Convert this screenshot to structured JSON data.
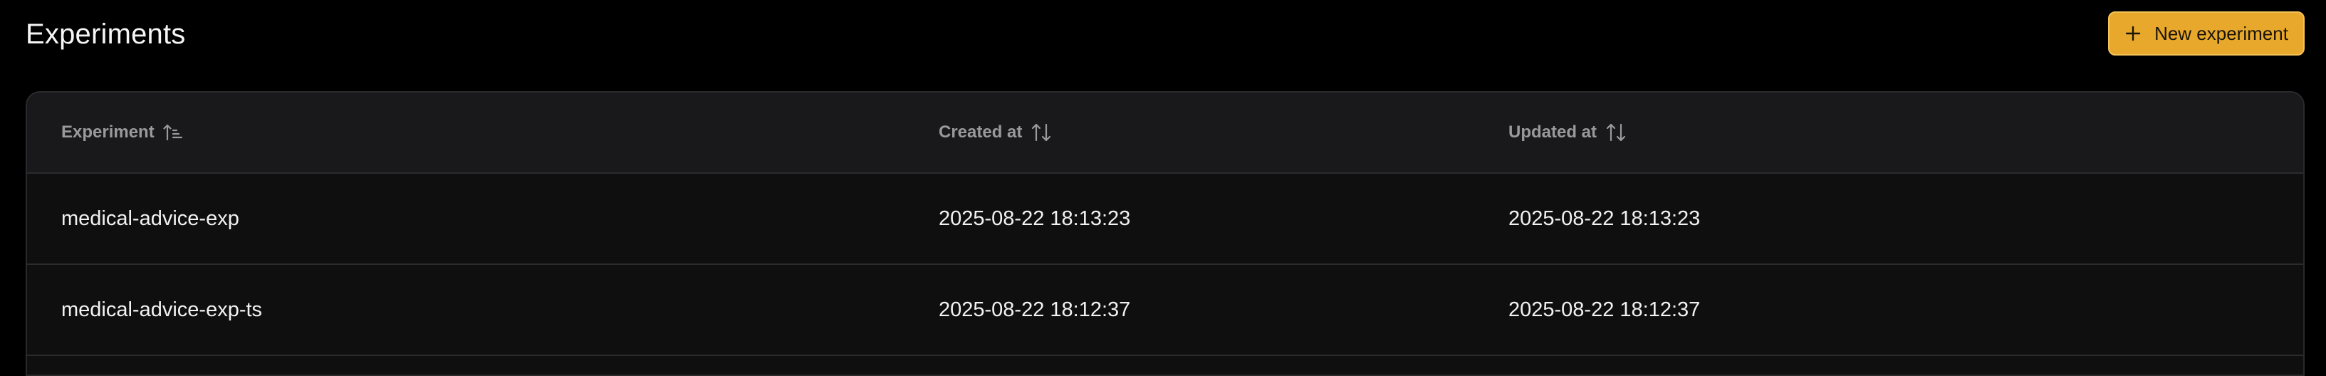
{
  "header": {
    "title": "Experiments",
    "new_button_label": "New experiment"
  },
  "table": {
    "columns": [
      {
        "label": "Experiment",
        "sort": "ascending"
      },
      {
        "label": "Created at",
        "sort": "none"
      },
      {
        "label": "Updated at",
        "sort": "none"
      }
    ],
    "rows": [
      {
        "name": "medical-advice-exp",
        "created_at": "2025-08-22 18:13:23",
        "updated_at": "2025-08-22 18:13:23"
      },
      {
        "name": "medical-advice-exp-ts",
        "created_at": "2025-08-22 18:12:37",
        "updated_at": "2025-08-22 18:12:37"
      }
    ]
  },
  "colors": {
    "background": "#000000",
    "accent": "#e8a82c"
  },
  "icons": [
    "plus-icon",
    "sort-ascending-icon",
    "sort-both-icon"
  ]
}
